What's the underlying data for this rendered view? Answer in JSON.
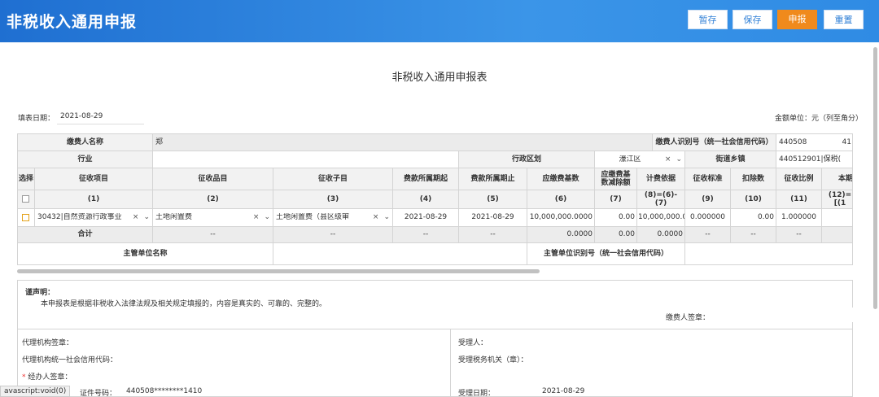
{
  "header": {
    "title": "非税收入通用申报",
    "buttons": {
      "stash": "暂存",
      "save": "保存",
      "submit": "申报",
      "reset": "重置"
    },
    "colors": {
      "bar": "#2f80d8",
      "submit": "#f08a1c"
    }
  },
  "form": {
    "title": "非税收入通用申报表",
    "fill_date_label": "填表日期：",
    "fill_date": "2021-08-29",
    "unit_note": "金额单位：元（列至角分）"
  },
  "table": {
    "payer_name_label": "缴费人名称",
    "payer_name_value": "郑",
    "payer_id_label": "缴费人识别号（统一社会信用代码）",
    "payer_id_value": "440508",
    "payer_id_tail": "41",
    "industry_label": "行业",
    "admin_region_label": "行政区划",
    "admin_region_value": "濠江区",
    "street_label": "街道乡镇",
    "street_value": "440512901|保税(",
    "columns": {
      "select": "选择",
      "item": "征收项目",
      "category": "征收品目",
      "subcategory": "征收子目",
      "period_start": "费款所属期起",
      "period_end": "费款所属期止",
      "base": "应缴费基数",
      "deduct": "应缴费基数减除额",
      "calc_basis": "计费依据",
      "standard": "征收标准",
      "deduction": "扣除数",
      "ratio": "征收比例",
      "current": "本期"
    },
    "column_numbers": {
      "item": "(1)",
      "category": "(2)",
      "subcategory": "(3)",
      "period_start": "(4)",
      "period_end": "(5)",
      "base": "(6)",
      "deduct": "(7)",
      "calc_basis": "(8)=(6)-(7)",
      "standard": "(9)",
      "deduction": "(10)",
      "ratio": "(11)",
      "current": "(12)=[(1"
    },
    "row": {
      "item": "30432|自然资源行政事业",
      "category": "土地闲置费",
      "subcategory": "土地闲置费（县区级审",
      "period_start": "2021-08-29",
      "period_end": "2021-08-29",
      "base": "10,000,000.0000",
      "deduct": "0.00",
      "calc_basis": "10,000,000.0",
      "standard": "0.000000",
      "deduction": "0.00",
      "ratio": "1.000000"
    },
    "total": {
      "label": "合计",
      "category": "--",
      "subcategory": "--",
      "period_start": "--",
      "period_end": "--",
      "base": "0.0000",
      "deduct": "0.00",
      "calc_basis": "0.0000",
      "standard": "--",
      "deduction": "--",
      "ratio": "--"
    },
    "supervisor_name_label": "主管单位名称",
    "supervisor_id_label": "主管单位识别号（统一社会信用代码）",
    "clear_glyph": "×",
    "dropdown_glyph": "⌄"
  },
  "declaration": {
    "title": "谨声明：",
    "text": "本申报表是根据非税收入法律法规及相关规定填报的，内容是真实的、可靠的、完整的。",
    "payer_sign_label": "缴费人签章："
  },
  "agent": {
    "agency_seal_label": "代理机构签章：",
    "agency_credit_label": "代理机构统一社会信用代码：",
    "operator_sign_label": "经办人签章：",
    "required_mark": "*",
    "id_label": "证件号码：",
    "id_value": "440508********1410",
    "receiver_label": "受理人：",
    "receiving_office_label": "受理税务机关（章）：",
    "receive_date_label": "受理日期：",
    "receive_date_value": "2021-08-29"
  },
  "status_bar": "avascript:void(0)"
}
